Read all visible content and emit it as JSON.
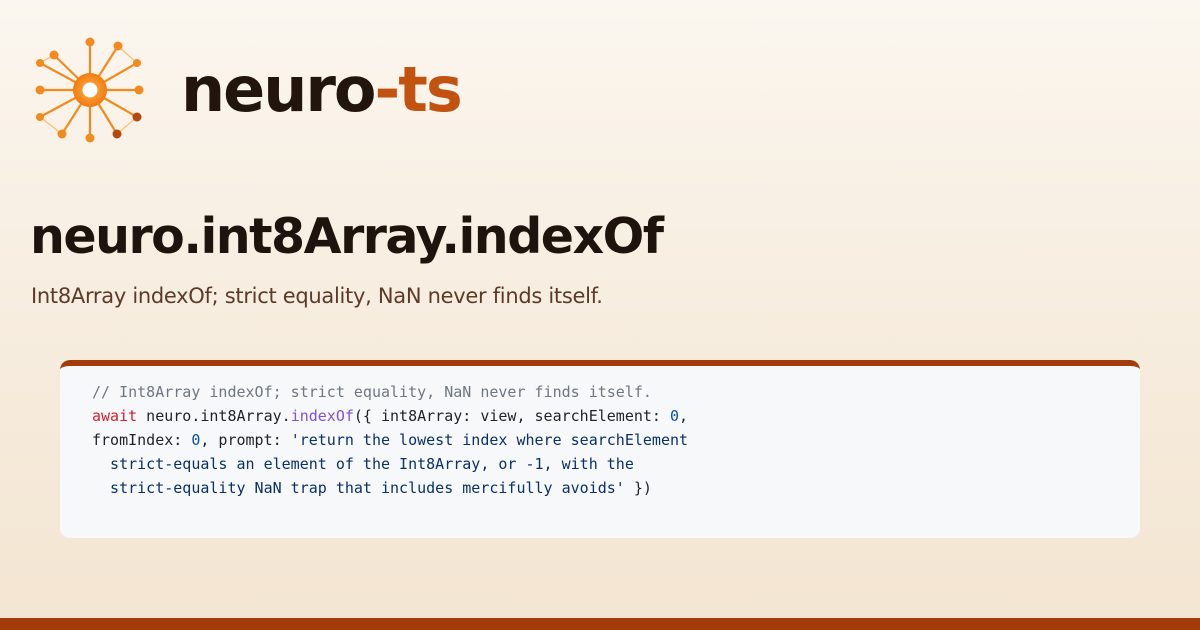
{
  "brand": {
    "name_primary": "neuro",
    "name_accent": "-ts",
    "logo_icon": "neural-sunburst-icon"
  },
  "page": {
    "title": "neuro.int8Array.indexOf",
    "subtitle": "Int8Array indexOf; strict equality, NaN never finds itself."
  },
  "code": {
    "comment": "// Int8Array indexOf; strict equality, NaN never finds itself.",
    "keyword_await": "await",
    "object_path": " neuro.int8Array.",
    "method": "indexOf",
    "args_open": "({ int8Array: view, searchElement: ",
    "search_value": "0",
    "args_comma": ",",
    "from_key": "fromIndex: ",
    "from_value": "0",
    "prompt_key": ", prompt: ",
    "prompt_line1": "'return the lowest index where searchElement",
    "prompt_line2": "  strict-equals an element of the Int8Array, or -1, with the",
    "prompt_line3": "  strict-equality NaN trap that includes mercifully avoids'",
    "args_close": " })"
  },
  "colors": {
    "accent": "#c2520f",
    "bar": "#a33b0b",
    "logo_orange": "#f28a1e",
    "logo_dark": "#b5480f",
    "text_dark": "#1f140d",
    "subtitle": "#5b3b28",
    "code_bg": "#f6f8fa"
  }
}
